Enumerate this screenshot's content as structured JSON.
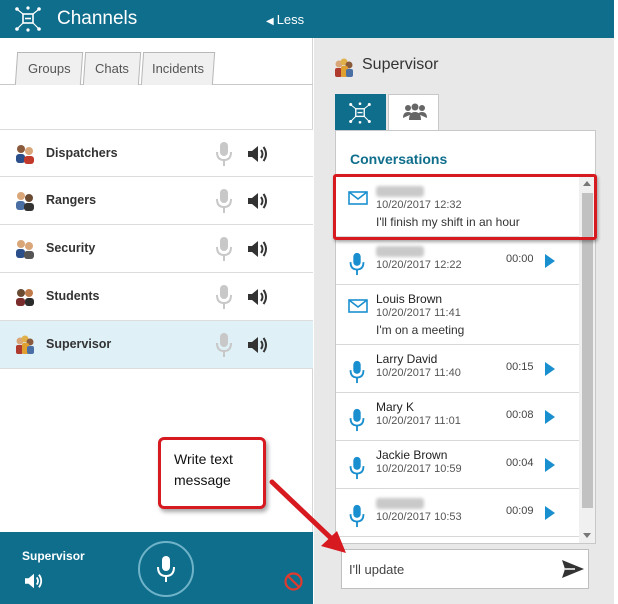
{
  "header": {
    "title": "Channels",
    "less_label": "Less",
    "less_glyph": "◀"
  },
  "left_tabs": [
    {
      "label": "Groups"
    },
    {
      "label": "Chats"
    },
    {
      "label": "Incidents"
    }
  ],
  "channels": [
    {
      "name": "Dispatchers",
      "icon": "group-avatar-icon"
    },
    {
      "name": "Rangers",
      "icon": "group-avatar-icon"
    },
    {
      "name": "Security",
      "icon": "group-avatar-icon"
    },
    {
      "name": "Students",
      "icon": "group-avatar-icon"
    },
    {
      "name": "Supervisor",
      "icon": "group-avatar-icon",
      "selected": true
    }
  ],
  "bottom_bar": {
    "channel_name": "Supervisor"
  },
  "right_panel": {
    "title": "Supervisor",
    "section_title": "Conversations",
    "conversations": [
      {
        "type": "text",
        "sender": "",
        "date": "10/20/2017 12:32",
        "message": "I'll finish my shift in an hour"
      },
      {
        "type": "voice",
        "sender": "",
        "date": "10/20/2017 12:22",
        "duration": "00:00"
      },
      {
        "type": "text",
        "sender": "Louis Brown",
        "date": "10/20/2017 11:41",
        "message": "I'm on a meeting"
      },
      {
        "type": "voice",
        "sender": "Larry David",
        "date": "10/20/2017 11:40",
        "duration": "00:15"
      },
      {
        "type": "voice",
        "sender": "Mary K",
        "date": "10/20/2017 11:01",
        "duration": "00:08"
      },
      {
        "type": "voice",
        "sender": "Jackie Brown",
        "date": "10/20/2017 10:59",
        "duration": "00:04"
      },
      {
        "type": "voice",
        "sender": "",
        "date": "10/20/2017 10:53",
        "duration": "00:09"
      }
    ],
    "message_input": {
      "value": "I'll update"
    }
  },
  "annotations": {
    "callout_text": "Write text message"
  },
  "colors": {
    "brand": "#0f6e8c",
    "accent": "#1a8fcf",
    "highlight": "#d71920"
  }
}
